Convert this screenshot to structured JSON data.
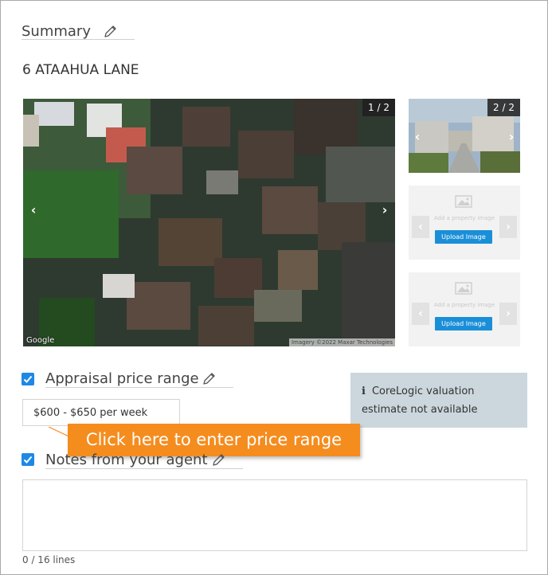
{
  "summary": {
    "title": "Summary",
    "edit_icon": "pencil-icon"
  },
  "property": {
    "address": "6 ATAAHUA LANE"
  },
  "gallery": {
    "main": {
      "counter": "1 / 2",
      "prev_icon": "chevron-left-icon",
      "next_icon": "chevron-right-icon",
      "google_label": "Google",
      "imagery_credit": "Imagery ©2022 Maxar Technologies"
    },
    "thumbnail": {
      "counter": "2 / 2",
      "prev_icon": "chevron-left-icon",
      "next_icon": "chevron-right-icon"
    },
    "placeholders": [
      {
        "text": "Add a property image",
        "button": "Upload Image",
        "icon": "image-icon"
      },
      {
        "text": "Add a property image",
        "button": "Upload Image",
        "icon": "image-icon"
      }
    ]
  },
  "appraisal": {
    "label": "Appraisal price range",
    "checked": true,
    "value": "$600 - $650 per week",
    "edit_icon": "pencil-icon"
  },
  "corelogic": {
    "icon": "info-icon",
    "text": "CoreLogic valuation estimate not available"
  },
  "callout": {
    "text": "Click here to enter price range"
  },
  "notes": {
    "label": "Notes from your agent",
    "checked": true,
    "edit_icon": "pencil-icon",
    "line_count": "0 / 16 lines"
  },
  "colors": {
    "accent": "#1e88e5",
    "upload_button": "#1a8fd8",
    "callout": "#f58c1e",
    "info_panel": "#ccd7dd"
  }
}
